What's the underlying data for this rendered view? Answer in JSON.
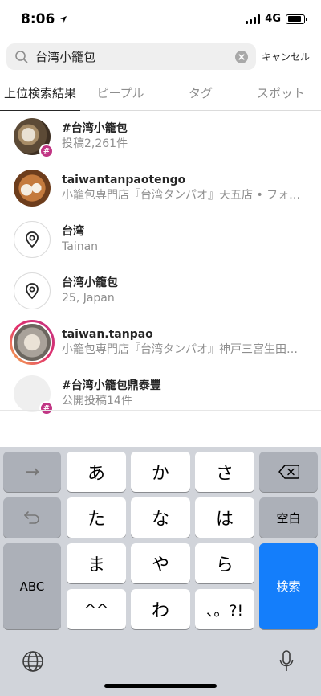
{
  "status": {
    "time": "8:06",
    "network": "4G"
  },
  "search": {
    "query": "台湾小籠包",
    "cancel_label": "キャンセル"
  },
  "tabs": [
    {
      "label": "上位検索結果",
      "active": true
    },
    {
      "label": "ピープル",
      "active": false
    },
    {
      "label": "タグ",
      "active": false
    },
    {
      "label": "スポット",
      "active": false
    }
  ],
  "results": [
    {
      "type": "hashtag",
      "title": "#台湾小籠包",
      "subtitle": "投稿2,261件"
    },
    {
      "type": "account",
      "title": "taiwantanpaotengo",
      "subtitle": "小籠包専門店『台湾タンパオ』天五店 • フォ…"
    },
    {
      "type": "place",
      "title": "台湾",
      "subtitle": "Tainan"
    },
    {
      "type": "place",
      "title": "台湾小籠包",
      "subtitle": "25, Japan"
    },
    {
      "type": "account",
      "title": "taiwan.tanpao",
      "subtitle": "小籠包専門店『台湾タンパオ』神戸三宮生田…"
    },
    {
      "type": "hashtag",
      "title": "#台湾小籠包鼎泰豐",
      "subtitle": "公開投稿14件"
    }
  ],
  "keyboard": {
    "row1": [
      "→",
      "あ",
      "か",
      "さ",
      "delete-icon"
    ],
    "row2": [
      "undo-icon",
      "た",
      "な",
      "は",
      "空白"
    ],
    "row3": [
      "ABC",
      "ま",
      "や",
      "ら",
      "検索"
    ],
    "row4": [
      "^^",
      "わ",
      "、。?!"
    ],
    "bottom": [
      "globe-icon",
      "microphone-icon"
    ]
  },
  "colors": {
    "accent_blue": "#147efb",
    "hashtag_badge": "#c13584",
    "keyboard_bg": "#d1d4da"
  }
}
